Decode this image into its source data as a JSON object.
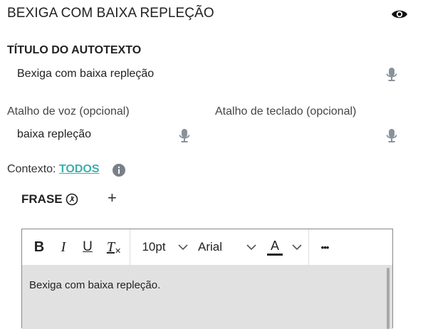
{
  "header": {
    "title": "BEXIGA COM BAIXA REPLEÇÃO",
    "eye_icon": "eye-icon"
  },
  "title_section": {
    "label": "TÍTULO DO AUTOTEXTO",
    "value": "Bexiga com baixa repleção"
  },
  "voice_shortcut": {
    "label": "Atalho de voz (opcional)",
    "value": "baixa repleção"
  },
  "keyboard_shortcut": {
    "label": "Atalho de teclado (opcional)",
    "value": ""
  },
  "context": {
    "label": "Contexto:",
    "link": "TODOS"
  },
  "phrase": {
    "label": "FRASE",
    "add": "+"
  },
  "editor": {
    "toolbar": {
      "bold": "B",
      "italic": "I",
      "underline": "U",
      "clear_format": "T",
      "font_size": "10pt",
      "font_family": "Arial",
      "font_color_letter": "A",
      "more": "•••"
    },
    "content": "Bexiga com baixa repleção."
  },
  "colors": {
    "link": "#3bb0ad",
    "editor_bg": "#e1e1e1",
    "icon_gray": "#8a9299"
  }
}
